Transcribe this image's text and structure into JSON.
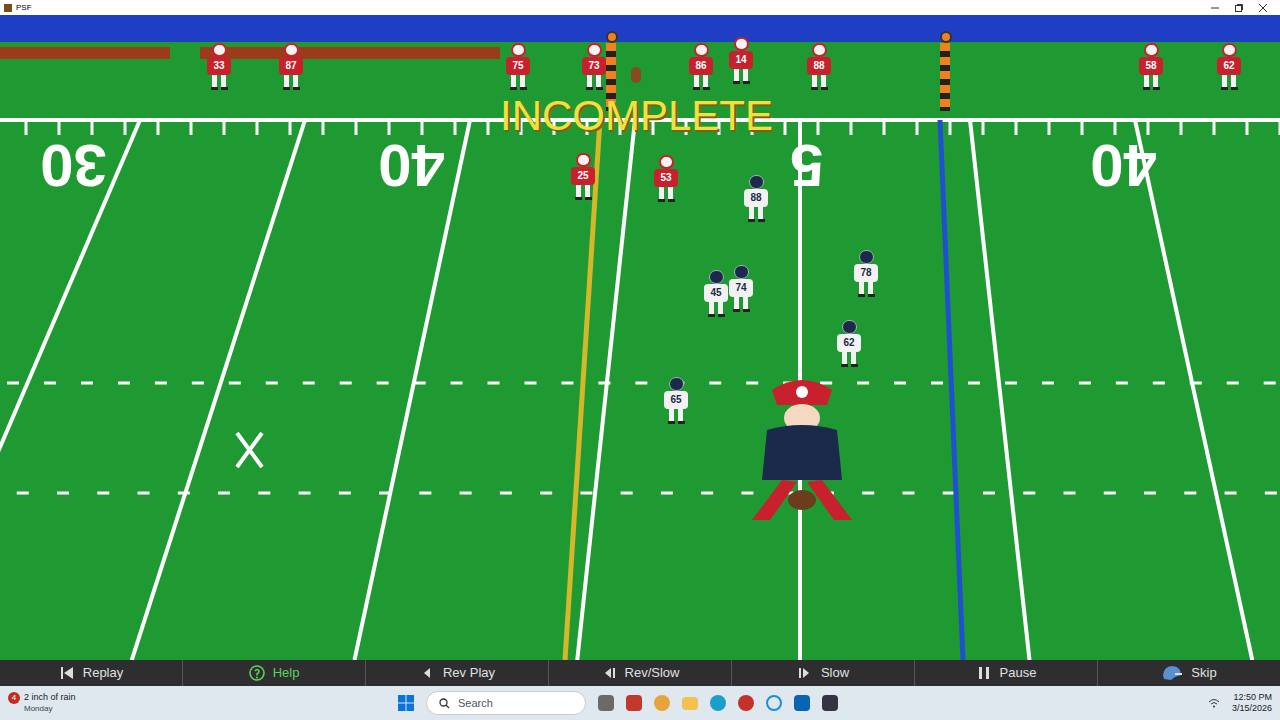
{
  "window": {
    "title": "PSF"
  },
  "field": {
    "yard_numbers": [
      "30",
      "40",
      "5",
      "40"
    ],
    "message": "INCOMPLETE"
  },
  "players": [
    {
      "number": "33",
      "color": "#c8202c"
    },
    {
      "number": "87",
      "color": "#c8202c"
    },
    {
      "number": "75",
      "color": "#c8202c"
    },
    {
      "number": "73",
      "color": "#c8202c"
    },
    {
      "number": "86",
      "color": "#c8202c"
    },
    {
      "number": "14",
      "color": "#c8202c"
    },
    {
      "number": "88",
      "color": "#c8202c"
    },
    {
      "number": "58",
      "color": "#c8202c"
    },
    {
      "number": "62",
      "color": "#c8202c"
    },
    {
      "number": "25",
      "color": "#c8202c"
    },
    {
      "number": "53",
      "color": "#c8202c"
    },
    {
      "number": "88",
      "color": "#f2f2f2"
    },
    {
      "number": "45",
      "color": "#f2f2f2"
    },
    {
      "number": "74",
      "color": "#f2f2f2"
    },
    {
      "number": "78",
      "color": "#f2f2f2"
    },
    {
      "number": "62",
      "color": "#f2f2f2"
    },
    {
      "number": "65",
      "color": "#f2f2f2"
    }
  ],
  "toolbar": {
    "buttons": [
      {
        "label": "Replay",
        "highlighted": false
      },
      {
        "label": "Help",
        "highlighted": true
      },
      {
        "label": "Rev Play",
        "highlighted": false
      },
      {
        "label": "Rev/Slow",
        "highlighted": false
      },
      {
        "label": "Slow",
        "highlighted": false
      },
      {
        "label": "Pause",
        "highlighted": false
      },
      {
        "label": "Skip",
        "highlighted": false
      }
    ]
  },
  "taskbar": {
    "weather": {
      "text": "2 inch of rain",
      "day": "Monday",
      "badge": "4"
    },
    "search": {
      "placeholder": "Search"
    },
    "clock": {
      "time": "12:50 PM",
      "date": "3/15/2026"
    }
  }
}
